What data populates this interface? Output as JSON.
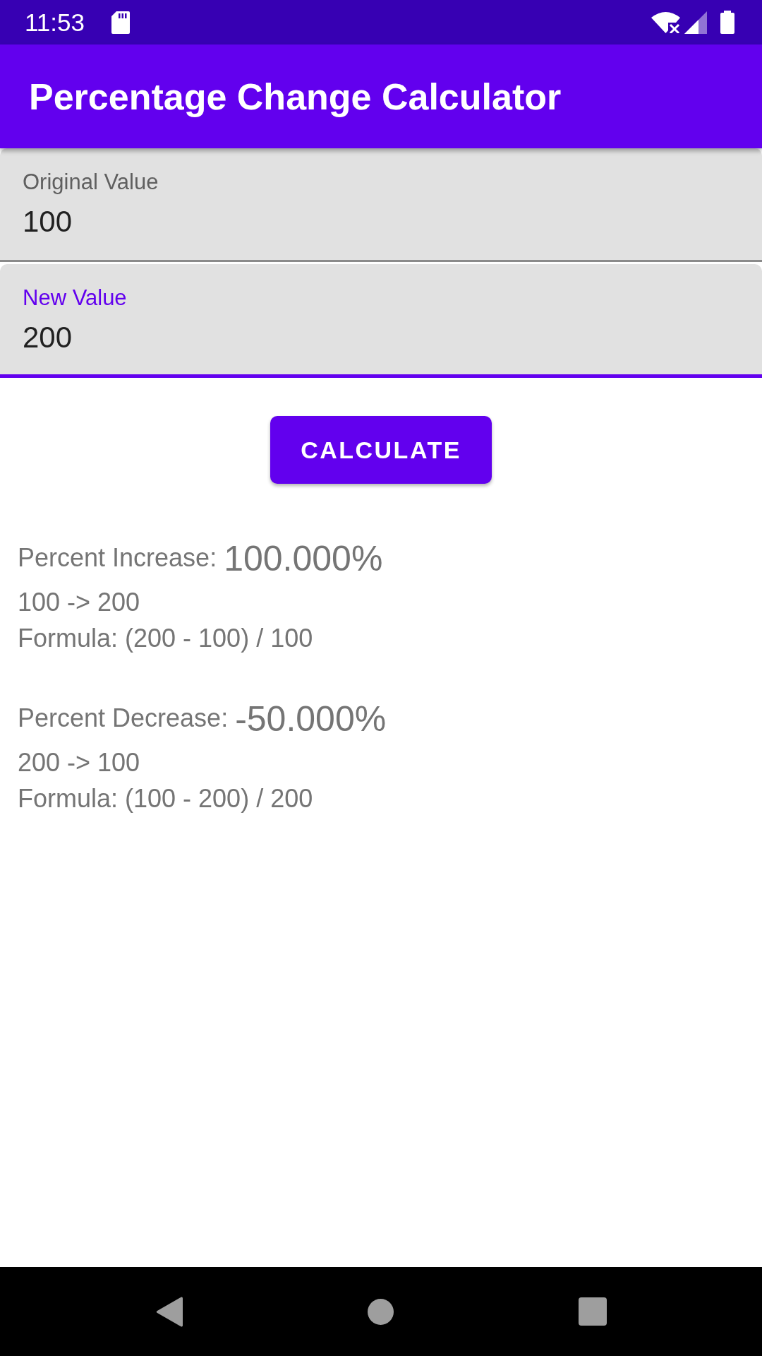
{
  "status_bar": {
    "time": "11:53"
  },
  "app_bar": {
    "title": "Percentage Change Calculator"
  },
  "fields": [
    {
      "label": "Original Value",
      "value": "100",
      "focused": false
    },
    {
      "label": "New Value",
      "value": "200",
      "focused": true
    }
  ],
  "calculate_button": {
    "label": "CALCULATE"
  },
  "results": [
    {
      "label": "Percent Increase:",
      "value": "100.000%",
      "change": "100 -> 200",
      "formula": "Formula: (200 - 100) / 100"
    },
    {
      "label": "Percent Decrease:",
      "value": "-50.000%",
      "change": "200 -> 100",
      "formula": "Formula: (100 - 200) / 200"
    }
  ]
}
